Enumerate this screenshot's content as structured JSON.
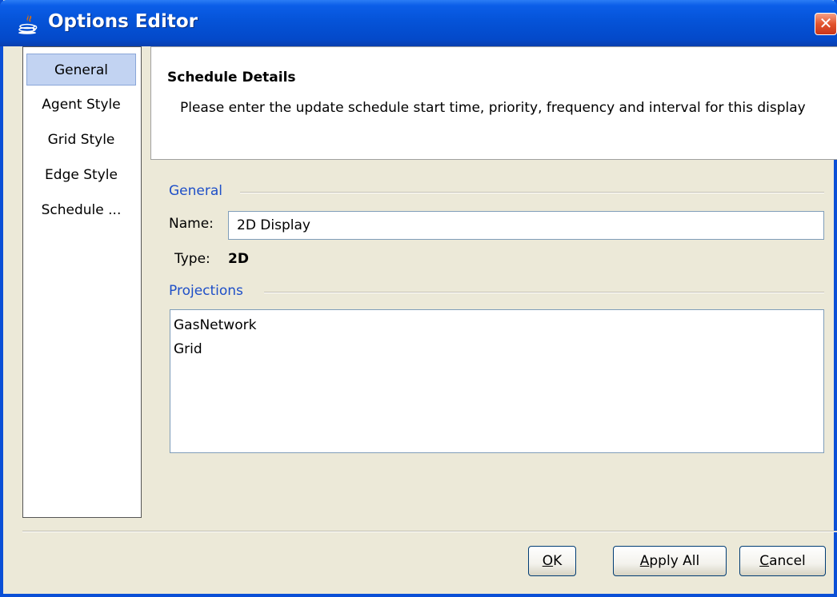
{
  "window": {
    "title": "Options Editor",
    "close_symbol": "✕"
  },
  "sidebar": {
    "items": [
      {
        "label": "General",
        "selected": true
      },
      {
        "label": "Agent Style",
        "selected": false
      },
      {
        "label": "Grid Style",
        "selected": false
      },
      {
        "label": "Edge Style",
        "selected": false
      },
      {
        "label": "Schedule ...",
        "selected": false
      }
    ]
  },
  "header": {
    "title": "Schedule Details",
    "description": "Please enter the update schedule start time, priority, frequency and interval for this display"
  },
  "general_section": {
    "label": "General",
    "name_label": "Name:",
    "name_value": "2D Display",
    "type_label": "Type:",
    "type_value": "2D"
  },
  "projections_section": {
    "label": "Projections",
    "items": [
      "GasNetwork",
      "Grid"
    ]
  },
  "buttons": {
    "ok": {
      "mnemonic": "O",
      "rest": "K"
    },
    "apply_all": {
      "mnemonic": "A",
      "rest": "pply All"
    },
    "cancel": {
      "mnemonic": "C",
      "rest": "ancel"
    }
  },
  "colors": {
    "titlebar": "#0553d8",
    "selection": "#c2d3f2",
    "section_label": "#1e4fc8",
    "close": "#e2542d"
  }
}
